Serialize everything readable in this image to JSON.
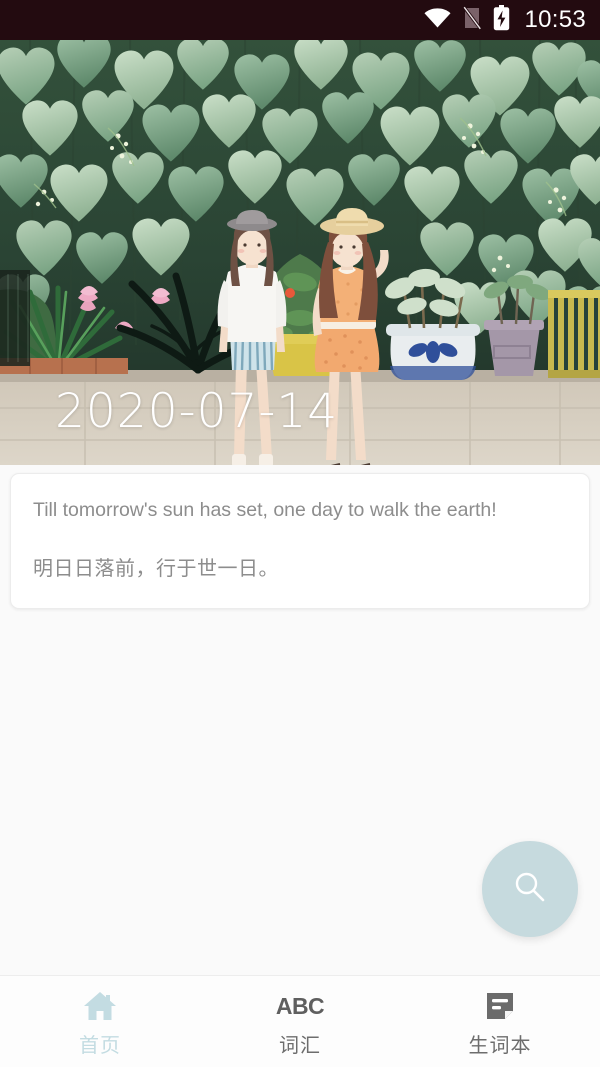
{
  "statusbar": {
    "time": "10:53",
    "icons": [
      "wifi-icon",
      "no-sim-icon",
      "battery-charging-icon"
    ],
    "background_color": "#230b10"
  },
  "hero": {
    "date": "2020-07-14",
    "alt": "illustration of two girls standing before a wall of heart-shaped green leaves with potted plants",
    "date_color": "#ffffff"
  },
  "quote_card": {
    "english": "Till tomorrow's sun has set, one day to walk the earth!",
    "chinese": "明日日落前，行于世一日。",
    "text_color": "#8d8d8d",
    "background_color": "#ffffff"
  },
  "fab": {
    "icon": "search-icon",
    "background_color": "#c6dade",
    "icon_color": "#ffffff"
  },
  "bottom_nav": {
    "items": [
      {
        "label": "首页",
        "icon": "home-icon",
        "active": true
      },
      {
        "label": "词汇",
        "icon": "abc-icon",
        "active": false
      },
      {
        "label": "生词本",
        "icon": "note-icon",
        "active": false
      }
    ],
    "active_color": "#c3dce2",
    "inactive_color": "#6d6d6d"
  }
}
